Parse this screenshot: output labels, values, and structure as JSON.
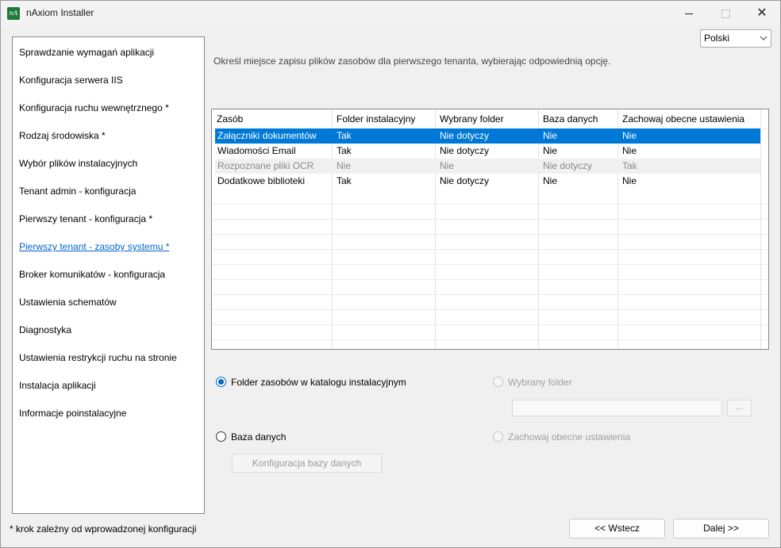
{
  "window": {
    "title": "nAxiom Installer",
    "icon_text": "nA"
  },
  "language": {
    "selected": "Polski"
  },
  "sidebar": {
    "items": [
      {
        "label": "Sprawdzanie wymagań aplikacji",
        "active": false
      },
      {
        "label": "Konfiguracja serwera IIS",
        "active": false
      },
      {
        "label": "Konfiguracja ruchu wewnętrznego *",
        "active": false
      },
      {
        "label": "Rodzaj środowiska *",
        "active": false
      },
      {
        "label": "Wybór plików instalacyjnych",
        "active": false
      },
      {
        "label": "Tenant admin - konfiguracja",
        "active": false
      },
      {
        "label": "Pierwszy tenant - konfiguracja *",
        "active": false
      },
      {
        "label": "Pierwszy tenant - zasoby systemu *",
        "active": true
      },
      {
        "label": "Broker komunikatów - konfiguracja",
        "active": false
      },
      {
        "label": "Ustawienia schematów",
        "active": false
      },
      {
        "label": "Diagnostyka",
        "active": false
      },
      {
        "label": "Ustawienia restrykcji ruchu na stronie",
        "active": false
      },
      {
        "label": "Instalacja aplikacji",
        "active": false
      },
      {
        "label": "Informacje poinstalacyjne",
        "active": false
      }
    ]
  },
  "main": {
    "instruction": "Określ miejsce zapisu plików zasobów dla pierwszego tenanta, wybierając odpowiednią opcję.",
    "table": {
      "columns": [
        "Zasób",
        "Folder instalacyjny",
        "Wybrany folder",
        "Baza danych",
        "Zachowaj obecne ustawienia"
      ],
      "rows": [
        {
          "cells": [
            "Załączniki dokumentów",
            "Tak",
            "Nie dotyczy",
            "Nie",
            "Nie"
          ],
          "state": "selected"
        },
        {
          "cells": [
            "Wiadomości Email",
            "Tak",
            "Nie dotyczy",
            "Nie",
            "Nie"
          ],
          "state": "normal"
        },
        {
          "cells": [
            "Rozpoznane pliki OCR",
            "Nie",
            "Nie",
            "Nie dotyczy",
            "Tak"
          ],
          "state": "disabled"
        },
        {
          "cells": [
            "Dodatkowe biblioteki",
            "Tak",
            "Nie dotyczy",
            "Nie",
            "Nie"
          ],
          "state": "normal"
        }
      ]
    },
    "options": {
      "install_folder": {
        "label": "Folder zasobów w katalogu instalacyjnym",
        "state": "checked"
      },
      "selected_folder": {
        "label": "Wybrany folder",
        "state": "disabled"
      },
      "folder_path": {
        "value": ""
      },
      "browse_label": "...",
      "database": {
        "label": "Baza danych",
        "state": "unchecked"
      },
      "keep_settings": {
        "label": "Zachowaj obecne ustawienia",
        "state": "disabled"
      },
      "db_config_button": "Konfiguracja bazy danych"
    }
  },
  "footer": {
    "note": "* krok zależny od wprowadzonej konfiguracji",
    "back_button": "<< Wstecz",
    "next_button": "Dalej >>"
  },
  "colors": {
    "accent": "#0067c0",
    "selection": "#0078d7",
    "active_link": "#0066cc",
    "disabled_text": "#a0a0a0"
  }
}
